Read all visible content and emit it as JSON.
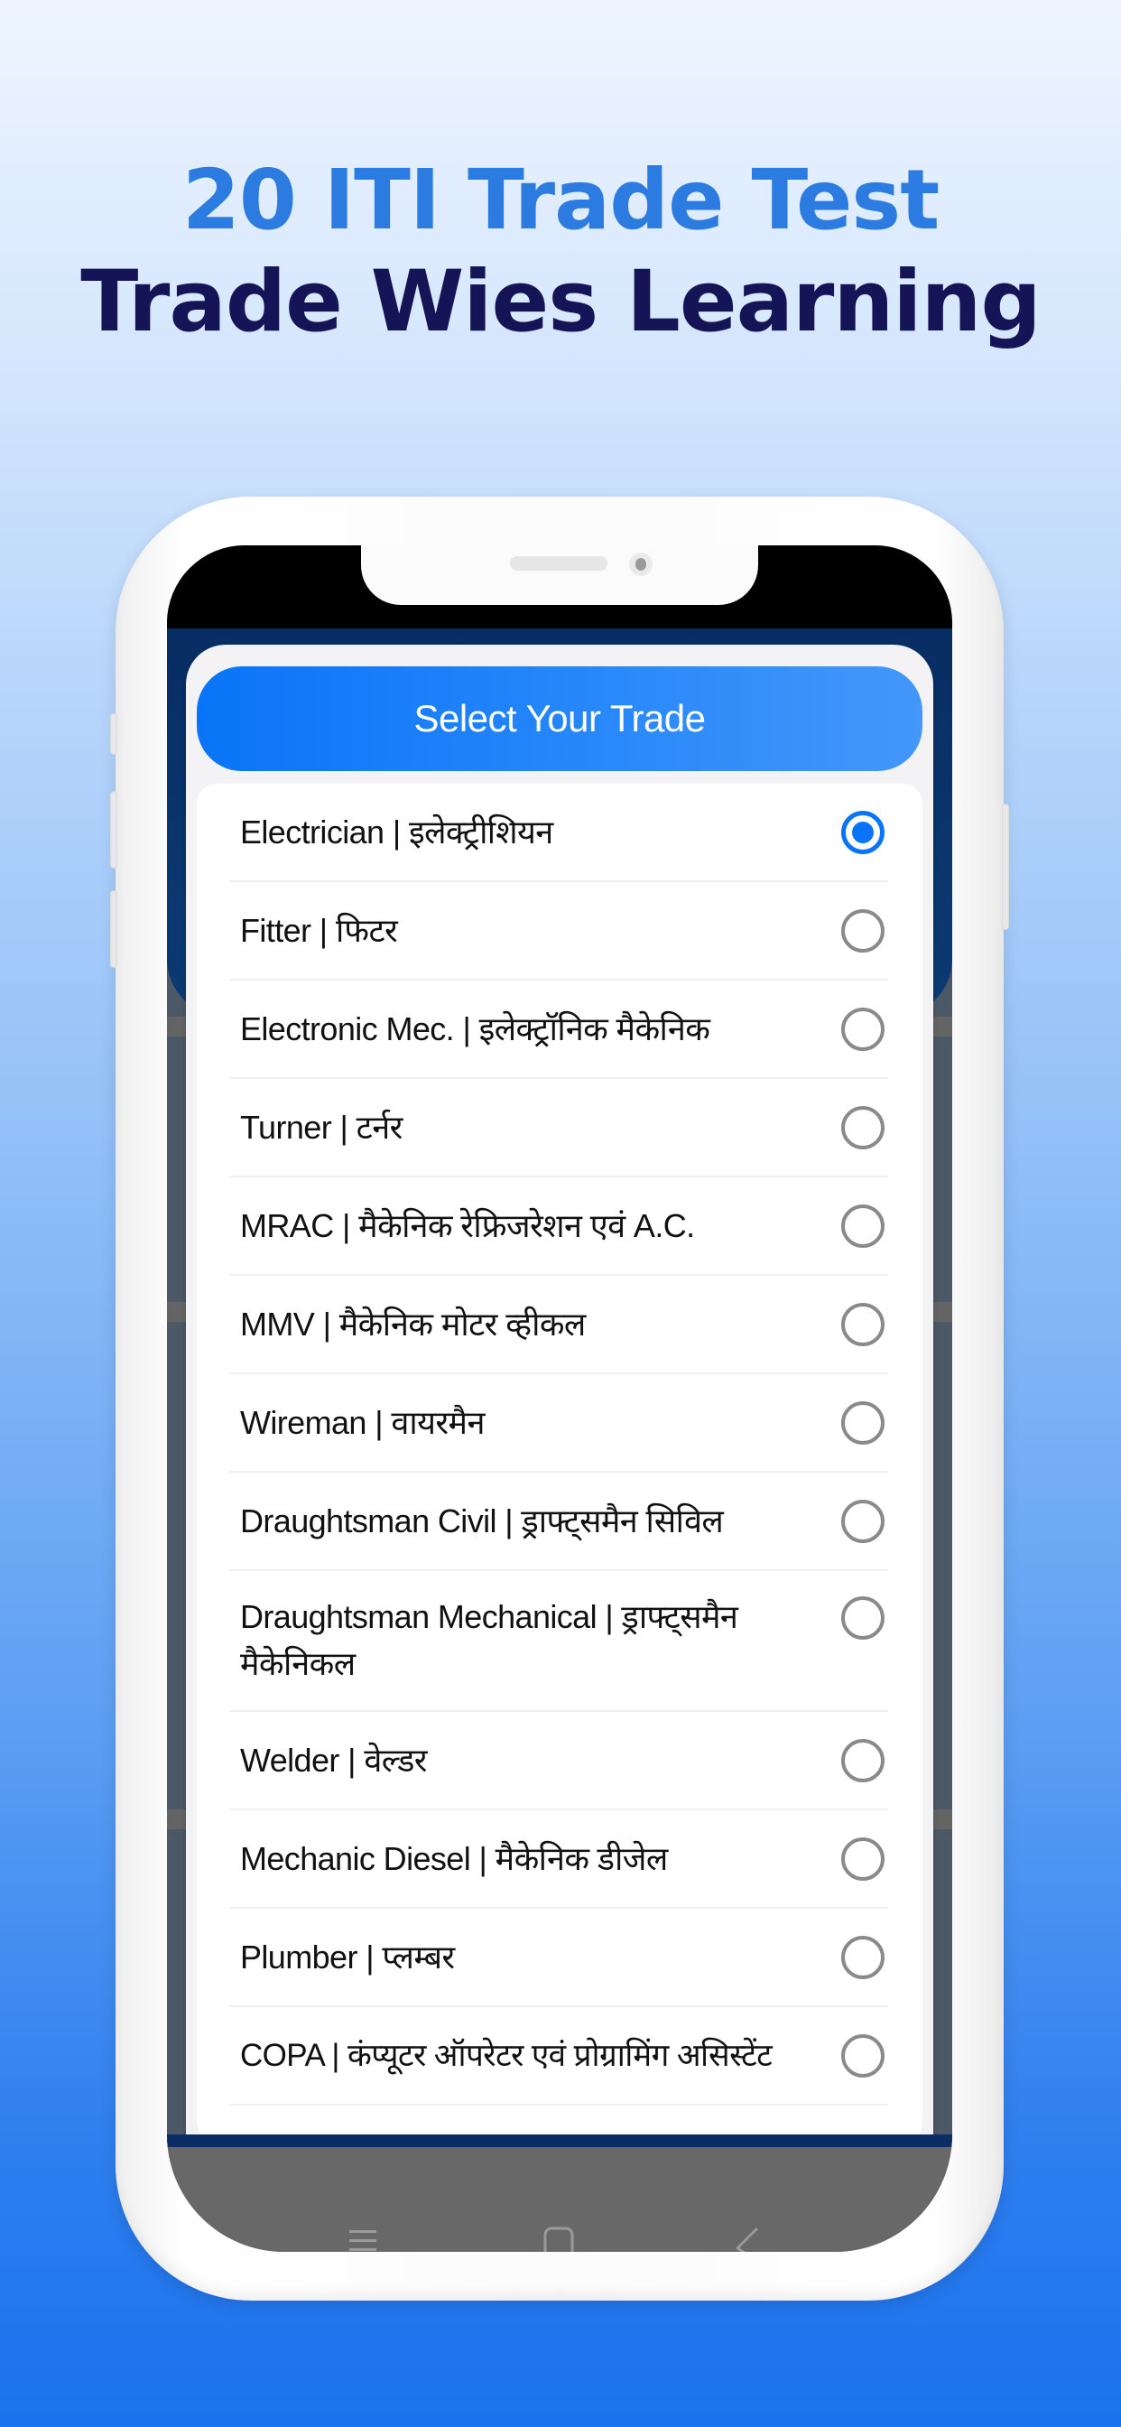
{
  "promo": {
    "headline_line1": "20 ITI Trade Test",
    "headline_line2": "Trade Wies Learning"
  },
  "colors": {
    "headline_accent": "#2c7be0",
    "headline_dark": "#141457",
    "primary": "#0a74f8",
    "app_header_navy": "#082d63"
  },
  "dialog": {
    "title": "Select Your Trade",
    "selected_index": 0,
    "options": [
      {
        "label": "Electrician | इलेक्ट्रीशियन",
        "selected": true
      },
      {
        "label": "Fitter | फिटर",
        "selected": false
      },
      {
        "label": "Electronic Mec. | इलेक्ट्रॉनिक मैकेनिक",
        "selected": false
      },
      {
        "label": "Turner | टर्नर",
        "selected": false
      },
      {
        "label": "MRAC | मैकेनिक रेफ्रिजरेशन एवं A.C.",
        "selected": false
      },
      {
        "label": "MMV | मैकेनिक मोटर व्हीकल",
        "selected": false
      },
      {
        "label": "Wireman | वायरमैन",
        "selected": false
      },
      {
        "label": "Draughtsman Civil | ड्राफ्ट्समैन सिविल",
        "selected": false
      },
      {
        "label": "Draughtsman Mechanical | ड्राफ्ट्समैन मैकेनिकल",
        "selected": false
      },
      {
        "label": "Welder | वेल्डर",
        "selected": false
      },
      {
        "label": "Mechanic Diesel | मैकेनिक डीजेल",
        "selected": false
      },
      {
        "label": "Plumber | प्लम्बर",
        "selected": false
      },
      {
        "label": "COPA | कंप्यूटर ऑपरेटर एवं प्रोग्रामिंग असिस्टेंट",
        "selected": false
      }
    ]
  },
  "nav": {
    "icons": [
      "menu-icon",
      "home-icon",
      "back-icon"
    ]
  }
}
